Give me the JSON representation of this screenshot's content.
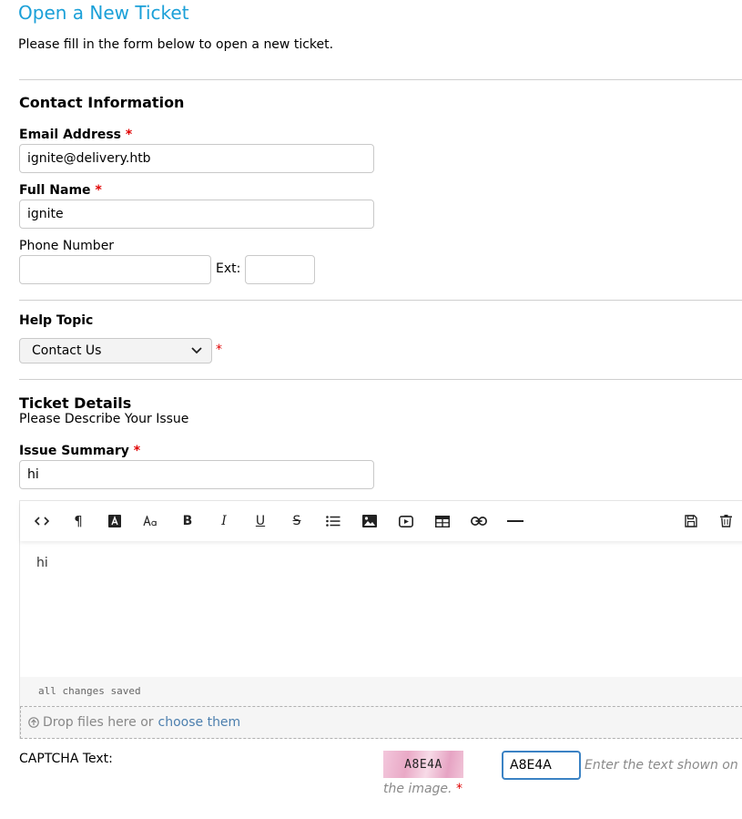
{
  "page": {
    "title": "Open a New Ticket",
    "intro": "Please fill in the form below to open a new ticket."
  },
  "contact": {
    "section_title": "Contact Information",
    "email_label": "Email Address",
    "email_value": "ignite@delivery.htb",
    "name_label": "Full Name",
    "name_value": "ignite",
    "phone_label": "Phone Number",
    "phone_value": "",
    "ext_label": "Ext:",
    "ext_value": ""
  },
  "help_topic": {
    "label": "Help Topic",
    "selected": "Contact Us"
  },
  "ticket": {
    "section_title": "Ticket Details",
    "subtitle": "Please Describe Your Issue",
    "summary_label": "Issue Summary",
    "summary_value": "hi",
    "body_text": "hi",
    "status": "all changes saved",
    "drop_text": "Drop files here or",
    "drop_link": "choose them"
  },
  "captcha": {
    "label": "CAPTCHA Text:",
    "image_text": "A8E4A",
    "input_value": "A8E4A",
    "hint_part1": "Enter the text shown on",
    "hint_part2": "the image."
  },
  "required_marker": "*",
  "colors": {
    "title": "#1ba0d8",
    "required": "#e00000",
    "link": "#4c7fae",
    "focus_border": "#3b82c4"
  }
}
